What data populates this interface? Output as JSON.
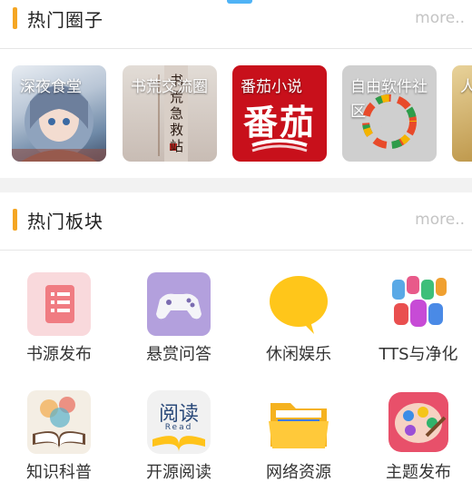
{
  "hot_circles": {
    "title": "热门圈子",
    "more": "more..",
    "items": [
      {
        "label": "深夜食堂"
      },
      {
        "label": "书荒交流圈"
      },
      {
        "label": "番茄小说"
      },
      {
        "label": "自由软件社区"
      },
      {
        "label": "人"
      }
    ]
  },
  "hot_boards": {
    "title": "热门板块",
    "more": "more..",
    "items": [
      {
        "label": "书源发布",
        "icon": "document-list-icon"
      },
      {
        "label": "悬赏问答",
        "icon": "gamepad-icon"
      },
      {
        "label": "休闲娱乐",
        "icon": "speech-bubble-icon"
      },
      {
        "label": "TTS与净化",
        "icon": "colorful-letters-icon"
      },
      {
        "label": "知识科普",
        "icon": "open-book-icon"
      },
      {
        "label": "开源阅读",
        "icon": "read-app-icon"
      },
      {
        "label": "网络资源",
        "icon": "folder-icon"
      },
      {
        "label": "主题发布",
        "icon": "palette-icon"
      }
    ]
  },
  "card_art": {
    "book_cover_text": "书荒急救站",
    "fanqie_logo_text": "番茄",
    "read_icon_text": "阅读",
    "read_icon_subtext": "Read"
  },
  "colors": {
    "accent_bar": "#f5a623",
    "more_text": "#c4c4c4",
    "fanqie_red": "#c8101b"
  }
}
